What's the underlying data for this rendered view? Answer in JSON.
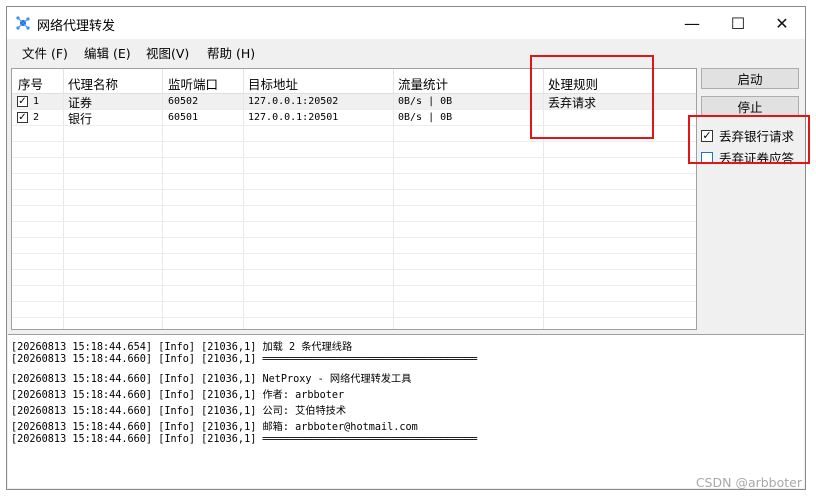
{
  "window": {
    "title": "网络代理转发",
    "controls": {
      "minimize": "—",
      "maximize": "☐",
      "close": "✕"
    }
  },
  "menu": {
    "items": [
      "文件 (F)",
      "编辑 (E)",
      "视图(V)",
      "帮助 (H)"
    ]
  },
  "grid": {
    "columns": [
      "序号",
      "代理名称",
      "监听端口",
      "目标地址",
      "流量统计",
      "处理规则"
    ],
    "rows": [
      {
        "checked": true,
        "index": "1",
        "name": "证券",
        "port": "60502",
        "target": "127.0.0.1:20502",
        "traffic": "0B/s | 0B",
        "rule": "丢弃请求"
      },
      {
        "checked": true,
        "index": "2",
        "name": "银行",
        "port": "60501",
        "target": "127.0.0.1:20501",
        "traffic": "0B/s | 0B",
        "rule": ""
      }
    ]
  },
  "buttons": {
    "start": "启动",
    "stop": "停止"
  },
  "options": [
    {
      "label": "丢弃银行请求",
      "checked": true
    },
    {
      "label": "丢弃证券应答",
      "checked": false
    }
  ],
  "log": {
    "lines": [
      "[20260813 15:18:44.654] [Info] [21036,1] 加载 2 条代理线路",
      "[20260813 15:18:44.660] [Info] [21036,1] ═══════════════════════════════════",
      "[20260813 15:18:44.660] [Info] [21036,1] NetProxy - 网络代理转发工具",
      "[20260813 15:18:44.660] [Info] [21036,1] 作者: arbboter",
      "[20260813 15:18:44.660] [Info] [21036,1] 公司: 艾伯特技术",
      "[20260813 15:18:44.660] [Info] [21036,1] 邮箱: arbboter@hotmail.com",
      "[20260813 15:18:44.660] [Info] [21036,1] ═══════════════════════════════════"
    ]
  },
  "watermark": "CSDN @arbboter",
  "colors": {
    "highlight": "#e21515",
    "checkbox_blue": "#1e6fd9",
    "row_selected": "#f0f0f0"
  }
}
